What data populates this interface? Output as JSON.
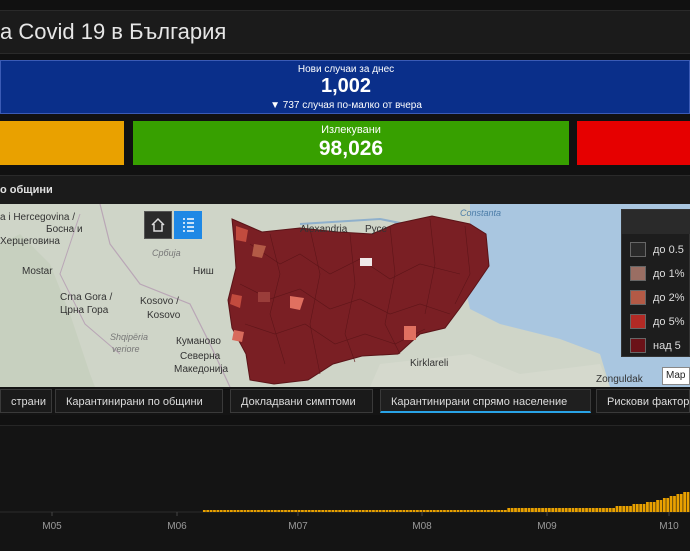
{
  "header": {
    "title": "a Covid 19 в България"
  },
  "new_cases": {
    "label": "Нови случаи за днес",
    "value": "1,002",
    "delta": "▼ 737 случая по-малко от вчера",
    "color": "#0a2f8a"
  },
  "indicators": {
    "left_color": "#e9a100",
    "recovered": {
      "label": "Излекувани",
      "value": "98,026",
      "color": "#37a000"
    },
    "right_color": "#e60000"
  },
  "map_section": {
    "title": "о общини"
  },
  "map": {
    "labels": {
      "bih": "a i Hercegovina /",
      "bosna": "Босна и",
      "hercegovina": "Херцеговина",
      "mostar": "Mostar",
      "montenegro": "Crna Gora /",
      "montenegro_cyr": "Црна Гора",
      "kosovo": "Kosovo /",
      "kosovo2": "Kosovo",
      "shqiperia": "Shqipëria",
      "veriore": "veriore",
      "kumanovo": "Куманово",
      "severna": "Северна",
      "makedonija": "Македонија",
      "srbija": "Србија",
      "nish": "Ниш",
      "alexandria": "Alexandria",
      "ruse": "Русе",
      "constanta": "Constanta",
      "kirklareli": "Kirklareli",
      "zonguldak": "Zonguldak",
      "map_type": "Map"
    },
    "legend": [
      {
        "label": "до 0.5",
        "color": "#2a2a2a"
      },
      {
        "label": "до 1%",
        "color": "#9a6e63"
      },
      {
        "label": "до 2%",
        "color": "#b35a46"
      },
      {
        "label": "до 5%",
        "color": "#b22a25"
      },
      {
        "label": "над 5",
        "color": "#6b1218"
      }
    ],
    "region_color": "#7a1f24"
  },
  "tabs": [
    {
      "label": "страни"
    },
    {
      "label": "Карантинирани по общини"
    },
    {
      "label": "Докладвани симптоми"
    },
    {
      "label": "Карантинирани спрямо население"
    },
    {
      "label": "Рискови фактори"
    }
  ],
  "chart_data": {
    "type": "bar",
    "x_ticks": [
      "M05",
      "M06",
      "M07",
      "M08",
      "M09",
      "M10"
    ],
    "series_color": "#e9a100",
    "values": [
      0,
      0,
      0,
      0,
      0,
      0,
      0,
      0,
      0,
      0,
      0,
      0,
      0,
      0,
      0,
      0,
      0,
      0,
      0,
      0,
      0,
      0,
      0,
      0,
      0,
      0,
      0,
      0,
      0,
      0,
      0,
      0,
      0,
      0,
      0,
      0,
      0,
      0,
      0,
      0,
      0,
      0,
      0,
      0,
      0,
      0,
      0,
      0,
      0,
      0,
      0,
      0,
      0,
      0,
      0,
      0,
      0,
      0,
      0,
      0,
      1,
      1,
      1,
      1,
      1,
      1,
      1,
      1,
      1,
      1,
      1,
      1,
      1,
      1,
      1,
      1,
      1,
      1,
      1,
      1,
      1,
      1,
      1,
      1,
      1,
      1,
      1,
      1,
      1,
      1,
      1,
      1,
      1,
      1,
      1,
      1,
      1,
      1,
      1,
      1,
      1,
      1,
      1,
      1,
      1,
      1,
      1,
      1,
      1,
      1,
      1,
      1,
      1,
      1,
      1,
      1,
      1,
      1,
      1,
      1,
      1,
      1,
      1,
      1,
      1,
      1,
      1,
      1,
      1,
      1,
      1,
      1,
      1,
      1,
      1,
      1,
      1,
      1,
      1,
      1,
      1,
      1,
      1,
      1,
      1,
      1,
      1,
      1,
      1,
      1,
      2,
      2,
      2,
      2,
      2,
      2,
      2,
      2,
      2,
      2,
      2,
      2,
      2,
      2,
      2,
      2,
      2,
      2,
      2,
      2,
      2,
      2,
      2,
      2,
      2,
      2,
      2,
      2,
      2,
      2,
      2,
      2,
      3,
      3,
      3,
      3,
      3,
      4,
      4,
      4,
      4,
      5,
      5,
      5,
      6,
      6,
      7,
      7,
      8,
      8,
      9,
      9,
      10,
      10
    ]
  }
}
